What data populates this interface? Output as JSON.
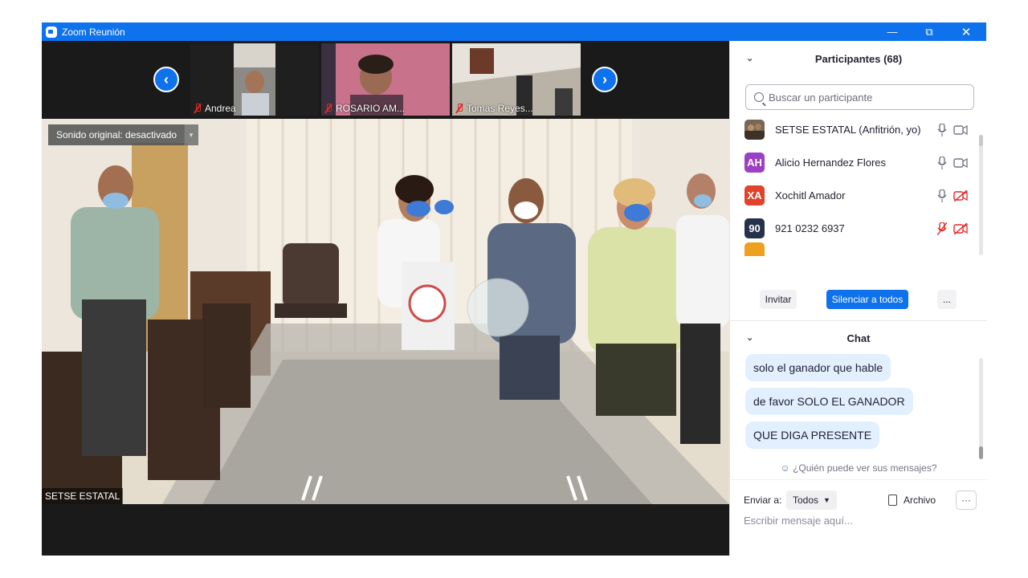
{
  "window": {
    "title": "Zoom Reunión",
    "minimize": "—",
    "restore": "⧉",
    "close": "✕"
  },
  "thumbnails": [
    {
      "name": "Andrea"
    },
    {
      "name": "ROSARIO AM..."
    },
    {
      "name": "Tomas Reyes..."
    }
  ],
  "nav": {
    "prev": "‹",
    "next": "›"
  },
  "main_video": {
    "sound_button": "Sonido original: desactivado",
    "sound_caret": "▾",
    "speaker": "SETSE ESTATAL"
  },
  "participants": {
    "header": "Participantes (68)",
    "search_placeholder": "Buscar un participante",
    "list": [
      {
        "initials": "",
        "name": "SETSE ESTATAL (Anfitrión, yo)",
        "color": "#6b5a48",
        "mic_muted": false,
        "cam_off": false
      },
      {
        "initials": "AH",
        "name": "Alicio Hernandez Flores",
        "color": "#9b3fc4",
        "mic_muted": false,
        "cam_off": false
      },
      {
        "initials": "XA",
        "name": "Xochitl Amador",
        "color": "#e0432c",
        "mic_muted": false,
        "cam_off": true
      },
      {
        "initials": "90",
        "name": "921 0232 6937",
        "color": "#25324a",
        "mic_muted": true,
        "cam_off": true
      }
    ],
    "invite_button": "Invitar",
    "mute_all_button": "Silenciar a todos",
    "more_button": "..."
  },
  "chat": {
    "header": "Chat",
    "messages": [
      "solo el ganador que hable",
      "de favor SOLO EL GANADOR",
      "QUE DIGA PRESENTE"
    ],
    "who_can_see": "¿Quién puede ver sus mensajes?",
    "send_to_label": "Enviar a:",
    "send_to_value": "Todos",
    "file_button": "Archivo",
    "more_button": "···",
    "input_placeholder": "Escribir mensaje aquí..."
  },
  "colors": {
    "titlebar": "#0e72ed",
    "accent": "#0e72ed",
    "bubble": "#e1efff",
    "muted": "#e02828"
  }
}
